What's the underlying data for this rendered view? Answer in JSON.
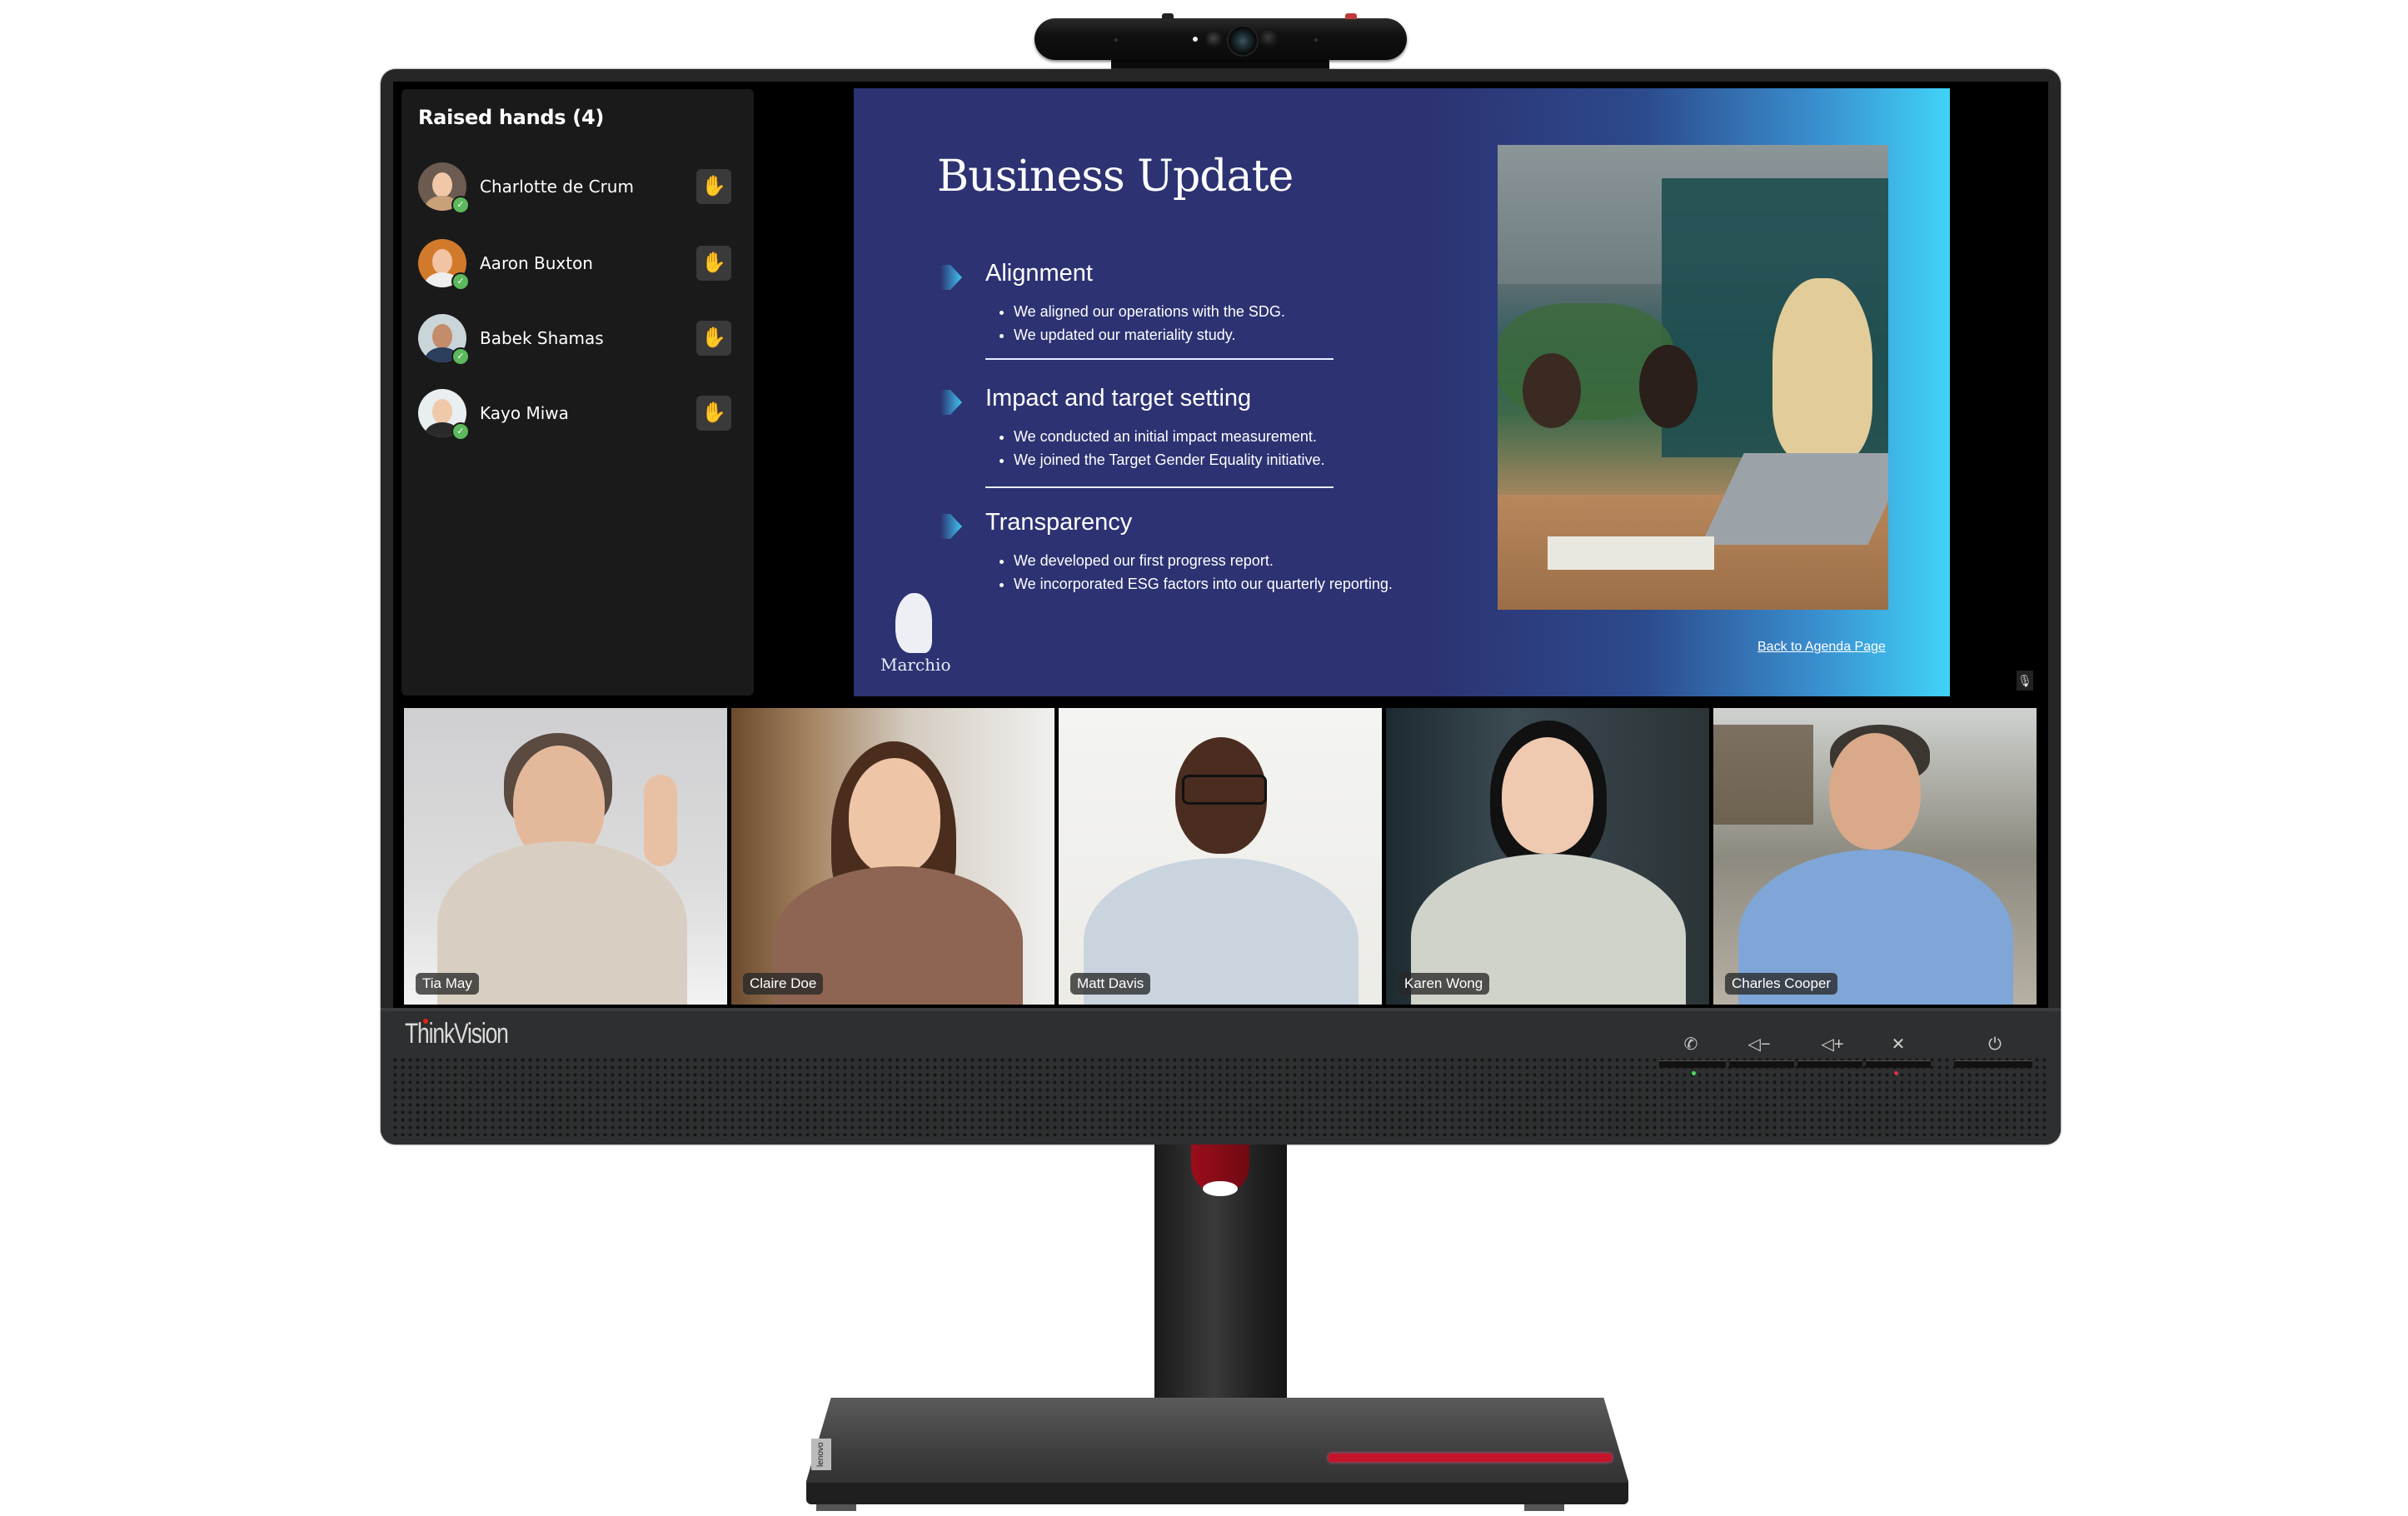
{
  "device": {
    "brand": "ThinkVision",
    "base_badge": "lenovo"
  },
  "raised_hands": {
    "title": "Raised hands (4)",
    "count": 4,
    "participants": [
      {
        "name": "Charlotte de Crum",
        "status": "available",
        "hand_icon": "✋"
      },
      {
        "name": "Aaron Buxton",
        "status": "available",
        "hand_icon": "✋"
      },
      {
        "name": "Babek Shamas",
        "status": "available",
        "hand_icon": "✋"
      },
      {
        "name": "Kayo Miwa",
        "status": "available",
        "hand_icon": "✋"
      }
    ],
    "status_glyph": "✓"
  },
  "slide": {
    "title": "Business Update",
    "sections": [
      {
        "heading": "Alignment",
        "bullets": [
          "We aligned our operations with the SDG.",
          "We updated our materiality study."
        ]
      },
      {
        "heading": "Impact and target setting",
        "bullets": [
          "We conducted an initial impact measurement.",
          "We joined the Target Gender Equality initiative."
        ]
      },
      {
        "heading": "Transparency",
        "bullets": [
          "We developed our first progress report.",
          "We incorporated ESG factors into our  quarterly reporting."
        ]
      }
    ],
    "logo_text": "Marchio",
    "back_link": "Back to Agenda Page",
    "colors": {
      "background": "#2c3272",
      "gradient_end": "#40d3f7"
    }
  },
  "presenter": {
    "mic_icon": "mic-off"
  },
  "video_tiles": [
    {
      "name": "Tia May"
    },
    {
      "name": "Claire Doe"
    },
    {
      "name": "Matt Davis"
    },
    {
      "name": "Karen Wong"
    },
    {
      "name": "Charles Cooper"
    }
  ],
  "controls": [
    {
      "name": "call",
      "glyph": "✆"
    },
    {
      "name": "volume-down",
      "glyph": "◁−"
    },
    {
      "name": "volume-up",
      "glyph": "◁+"
    },
    {
      "name": "mic-mute",
      "glyph": "✕"
    },
    {
      "name": "power",
      "glyph": "⏻"
    }
  ],
  "indicators": {
    "call_led": "#4cd964",
    "mute_led": "#e0304a"
  }
}
